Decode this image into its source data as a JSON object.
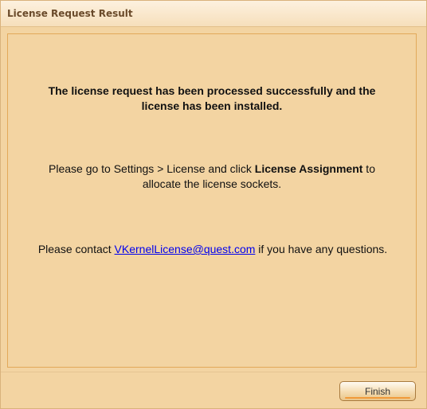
{
  "dialog": {
    "title": "License Request Result",
    "success_message_line1": "The license request has been processed successfully and the",
    "success_message_line2": "license has been installed.",
    "instruction_line1_prefix": "Please go to Settings > License and click ",
    "instruction_line1_bold": "License Assignment",
    "instruction_line1_suffix": " to",
    "instruction_line2": "allocate the license sockets.",
    "contact_prefix": "Please contact ",
    "contact_email": "VKernelLicense@quest.com",
    "contact_suffix": " if you have any questions.",
    "finish_label": "Finish"
  },
  "colors": {
    "panel_bg": "#f3d4a2",
    "border": "#e2a95a",
    "link": "#0000ee",
    "title_text": "#6a4a2a"
  }
}
